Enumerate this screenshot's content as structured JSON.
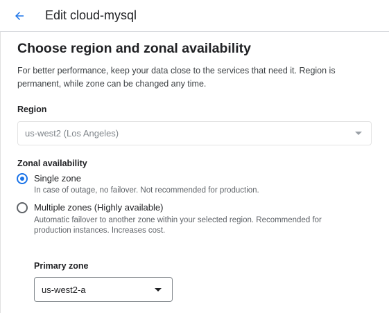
{
  "header": {
    "back_icon": "arrow-back-icon",
    "title": "Edit cloud-mysql"
  },
  "section": {
    "title": "Choose region and zonal availability",
    "description": "For better performance, keep your data close to the services that need it. Region is permanent, while zone can be changed any time."
  },
  "region": {
    "label": "Region",
    "value": "us-west2 (Los Angeles)",
    "disabled": true
  },
  "zonal": {
    "label": "Zonal availability",
    "options": [
      {
        "label": "Single zone",
        "help": "In case of outage, no failover. Not recommended for production.",
        "checked": true
      },
      {
        "label": "Multiple zones (Highly available)",
        "help": "Automatic failover to another zone within your selected region. Recommended for production instances. Increases cost.",
        "checked": false
      }
    ]
  },
  "primary_zone": {
    "label": "Primary zone",
    "value": "us-west2-a"
  },
  "colors": {
    "accent": "#1a73e8",
    "text": "#202124",
    "secondary_text": "#5f6368",
    "disabled_text": "#80868b",
    "border": "#dadce0"
  }
}
